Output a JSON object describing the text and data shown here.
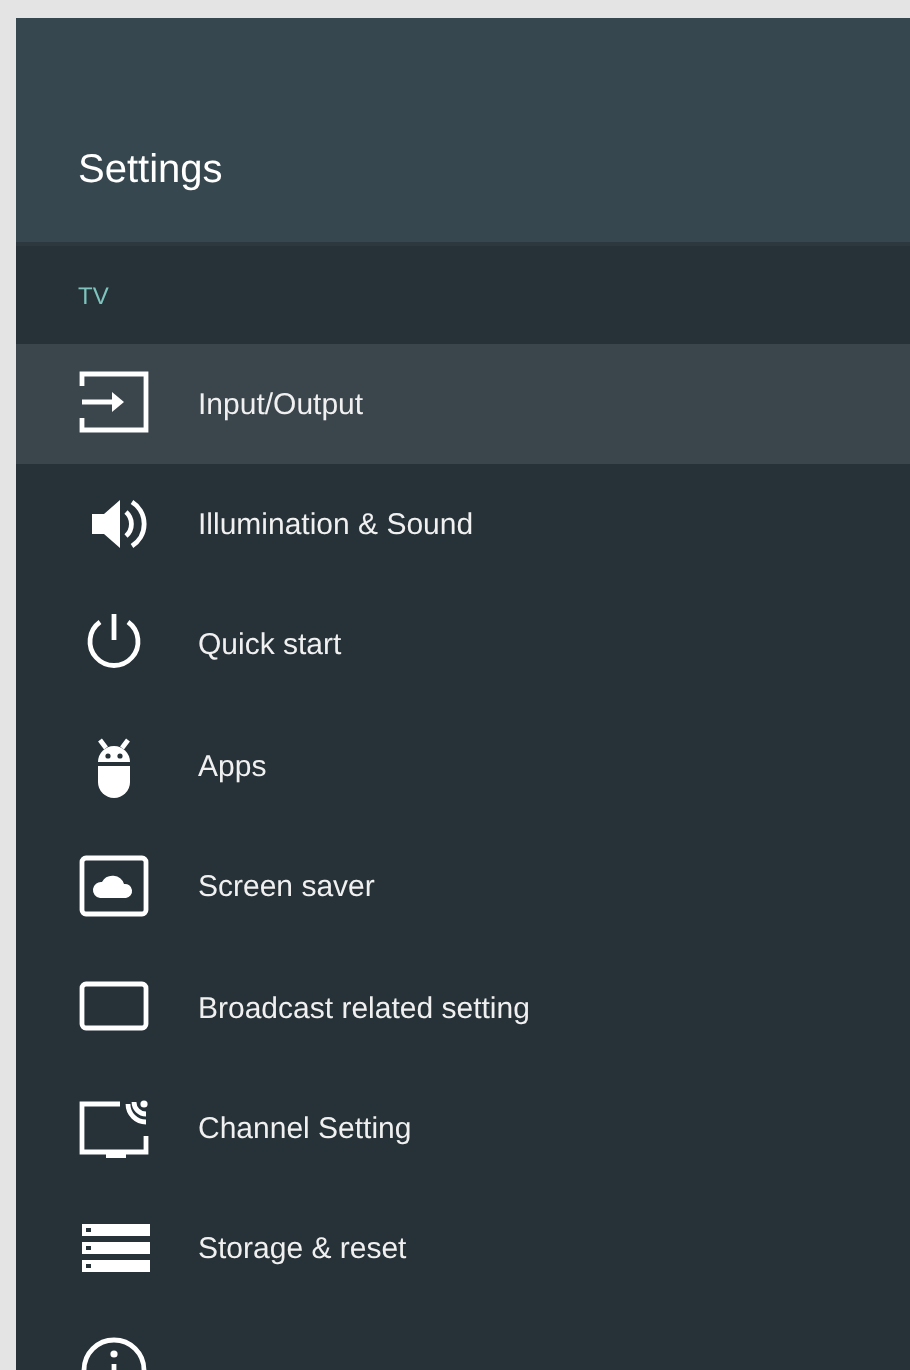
{
  "header": {
    "title": "Settings"
  },
  "section": {
    "label": "TV"
  },
  "items": [
    {
      "label": "Input/Output",
      "selected": true
    },
    {
      "label": "Illumination & Sound",
      "selected": false
    },
    {
      "label": "Quick start",
      "selected": false
    },
    {
      "label": "Apps",
      "selected": false
    },
    {
      "label": "Screen saver",
      "selected": false
    },
    {
      "label": "Broadcast related setting",
      "selected": false
    },
    {
      "label": "Channel Setting",
      "selected": false
    },
    {
      "label": "Storage & reset",
      "selected": false
    },
    {
      "selected": false
    }
  ]
}
